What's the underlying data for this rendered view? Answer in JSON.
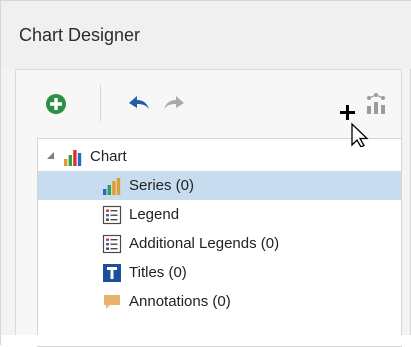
{
  "window": {
    "title": "Chart Designer"
  },
  "toolbar": {
    "add_icon": "plus-circle-icon",
    "undo_icon": "undo-arrow-icon",
    "redo_icon": "redo-arrow-icon",
    "wizard_icon": "chart-wizard-icon"
  },
  "tree": {
    "items": [
      {
        "label": "Chart",
        "icon": "chart-bar-icon",
        "expanded": true,
        "selected": false
      },
      {
        "label": "Series (0)",
        "icon": "series-bar-icon",
        "selected": true
      },
      {
        "label": "Legend",
        "icon": "legend-icon",
        "selected": false
      },
      {
        "label": "Additional Legends (0)",
        "icon": "legend-icon",
        "selected": false
      },
      {
        "label": "Titles (0)",
        "icon": "titles-icon",
        "selected": false
      },
      {
        "label": "Annotations (0)",
        "icon": "annotation-icon",
        "selected": false
      }
    ]
  },
  "colors": {
    "selection": "#c8dcf0",
    "add_green": "#2f8f46",
    "undo_blue": "#1f5fa8",
    "titles_blue": "#1a4f9c",
    "annotation_orange": "#e8b36b"
  }
}
